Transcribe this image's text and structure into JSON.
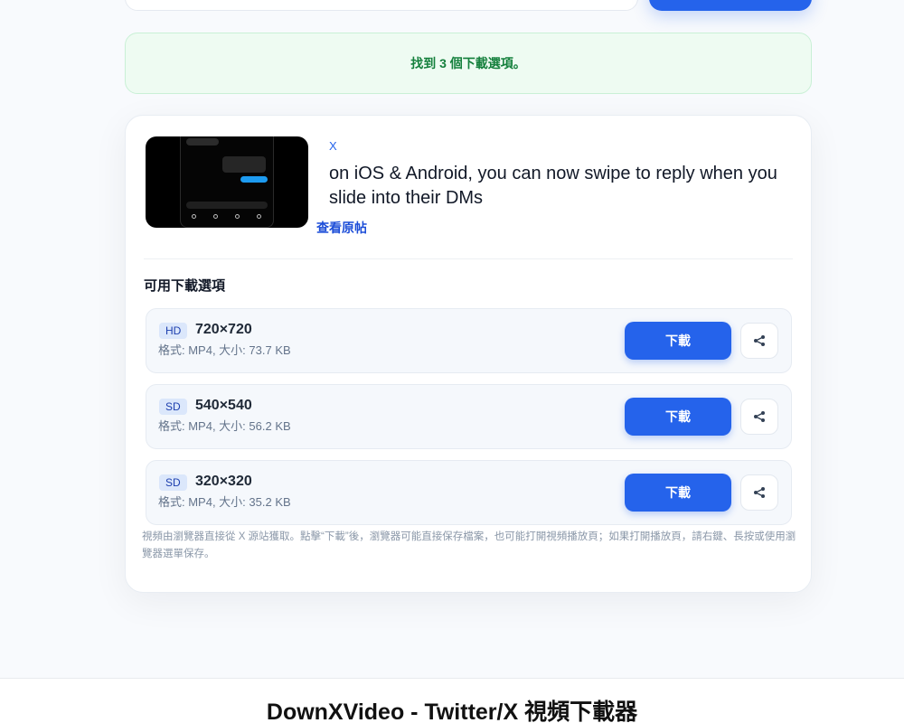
{
  "status": {
    "success_message": "找到 3 個下載選項。"
  },
  "video": {
    "source": "X",
    "title": "on iOS & Android, you can now swipe to reply when you slide into their DMs",
    "view_original_label": "查看原帖",
    "thumbnail_icon": "video-thumbnail"
  },
  "options_section": {
    "title": "可用下載選項",
    "options": [
      {
        "quality": "HD",
        "resolution": "720×720",
        "meta": "格式: MP4, 大小: 73.7 KB",
        "download_label": "下載",
        "share_icon": "share-icon"
      },
      {
        "quality": "SD",
        "resolution": "540×540",
        "meta": "格式: MP4, 大小: 56.2 KB",
        "download_label": "下載",
        "share_icon": "share-icon"
      },
      {
        "quality": "SD",
        "resolution": "320×320",
        "meta": "格式: MP4, 大小: 35.2 KB",
        "download_label": "下載",
        "share_icon": "share-icon"
      }
    ],
    "note": "視頻由瀏覽器直接從 X 源站獲取。點擊“下載”後，瀏覽器可能直接保存檔案，也可能打開視頻播放頁；如果打開播放頁，請右鍵、長按或使用瀏覽器選單保存。"
  },
  "footer": {
    "title": "DownXVideo - Twitter/X 視頻下載器"
  },
  "colors": {
    "accent": "#2563eb",
    "success_bg": "#eefbf2",
    "success_text": "#15803d",
    "badge_bg": "#dbe7fb"
  }
}
